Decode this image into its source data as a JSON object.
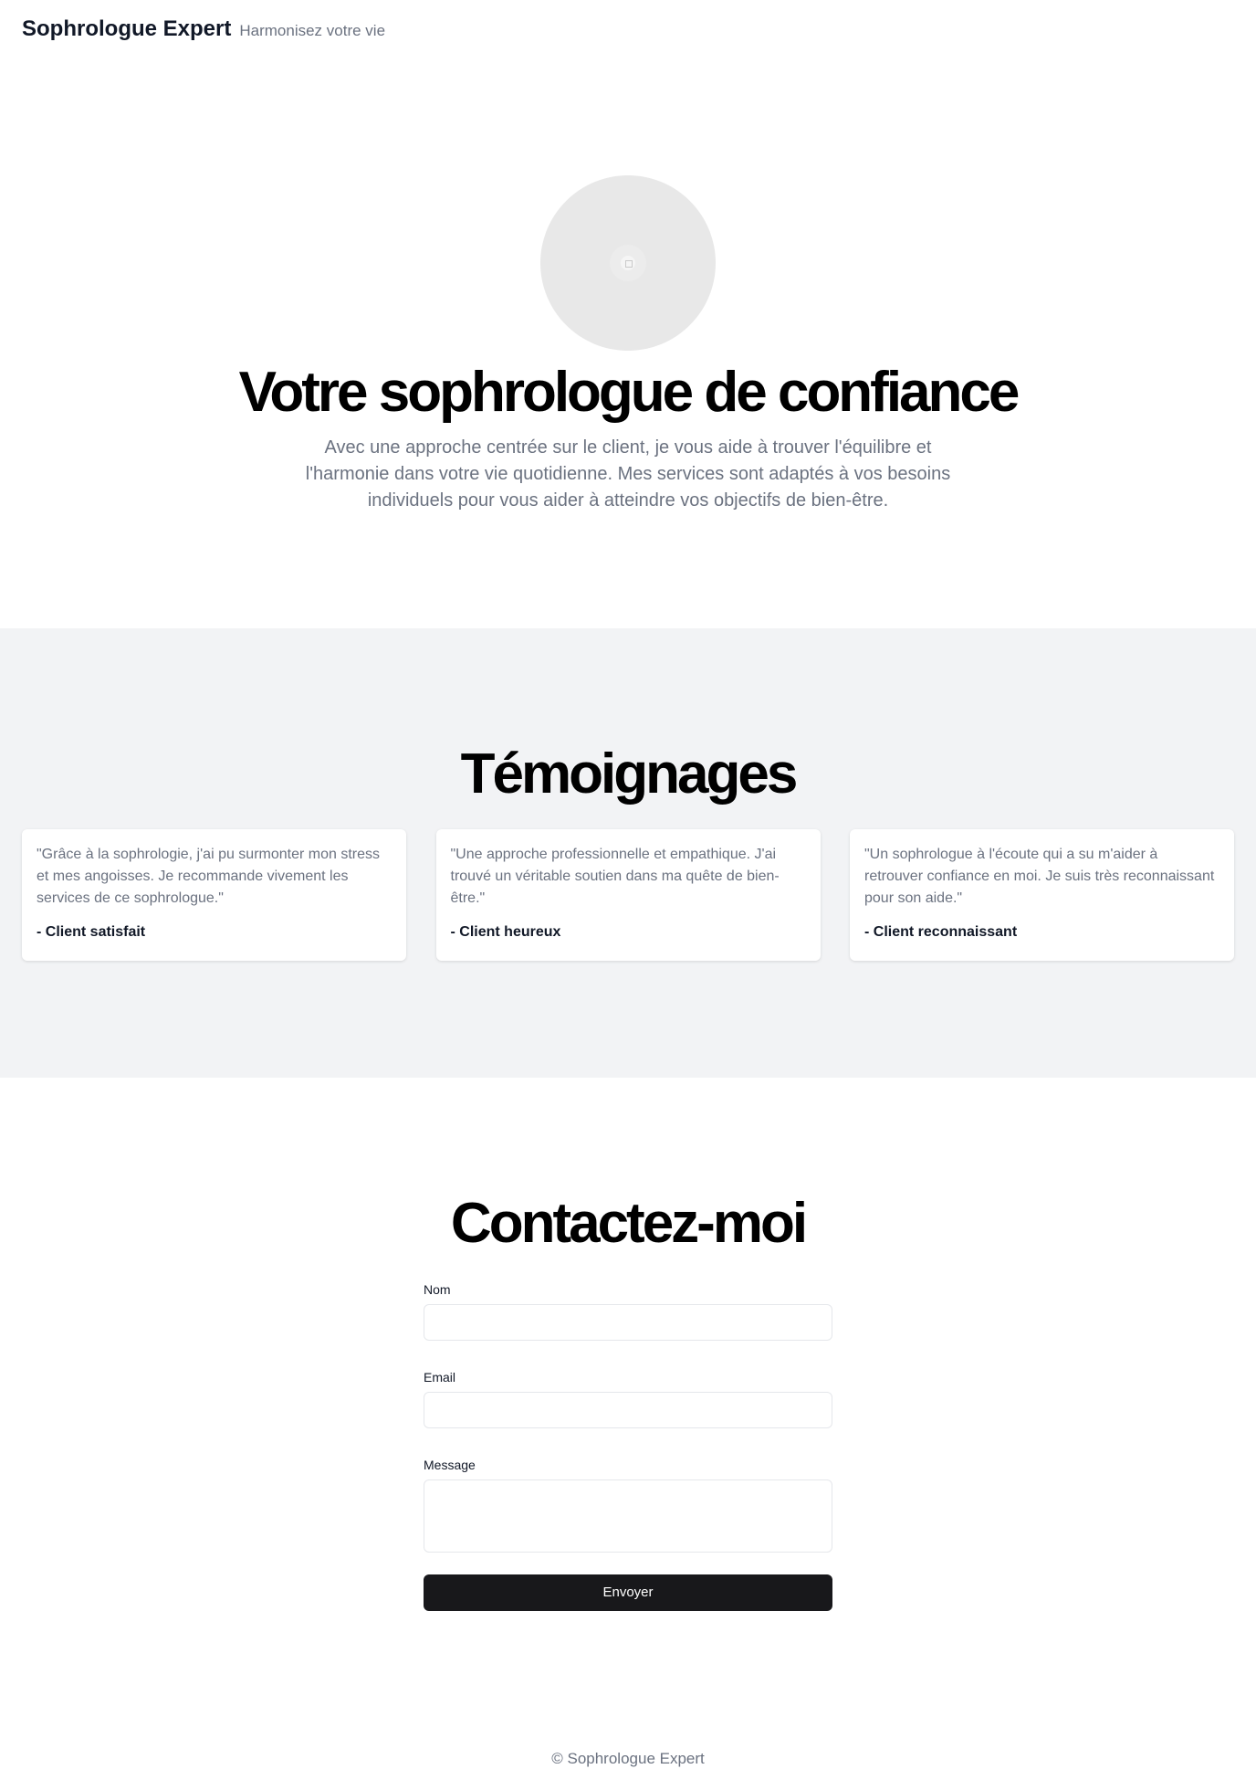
{
  "header": {
    "brand": "Sophrologue Expert",
    "tagline": "Harmonisez votre vie"
  },
  "hero": {
    "avatar_icon": "image-placeholder-icon",
    "title": "Votre sophrologue de confiance",
    "text": "Avec une approche centrée sur le client, je vous aide à trouver l'équilibre et l'harmonie dans votre vie quotidienne. Mes services sont adaptés à vos besoins individuels pour vous aider à atteindre vos objectifs de bien-être."
  },
  "testimonials": {
    "title": "Témoignages",
    "items": [
      {
        "quote": "\"Grâce à la sophrologie, j'ai pu surmonter mon stress et mes angoisses. Je recommande vivement les services de ce sophrologue.\"",
        "author": "- Client satisfait"
      },
      {
        "quote": "\"Une approche professionnelle et empathique. J'ai trouvé un véritable soutien dans ma quête de bien-être.\"",
        "author": "- Client heureux"
      },
      {
        "quote": "\"Un sophrologue à l'écoute qui a su m'aider à retrouver confiance en moi. Je suis très reconnaissant pour son aide.\"",
        "author": "- Client reconnaissant"
      }
    ]
  },
  "contact": {
    "title": "Contactez-moi",
    "name_label": "Nom",
    "name_value": "",
    "email_label": "Email",
    "email_value": "",
    "message_label": "Message",
    "message_value": "",
    "submit_label": "Envoyer"
  },
  "footer": {
    "text": "© Sophrologue Expert"
  },
  "colors": {
    "section_bg": "#f2f3f5",
    "muted_text": "#6b7280",
    "button_bg": "#18181b"
  }
}
